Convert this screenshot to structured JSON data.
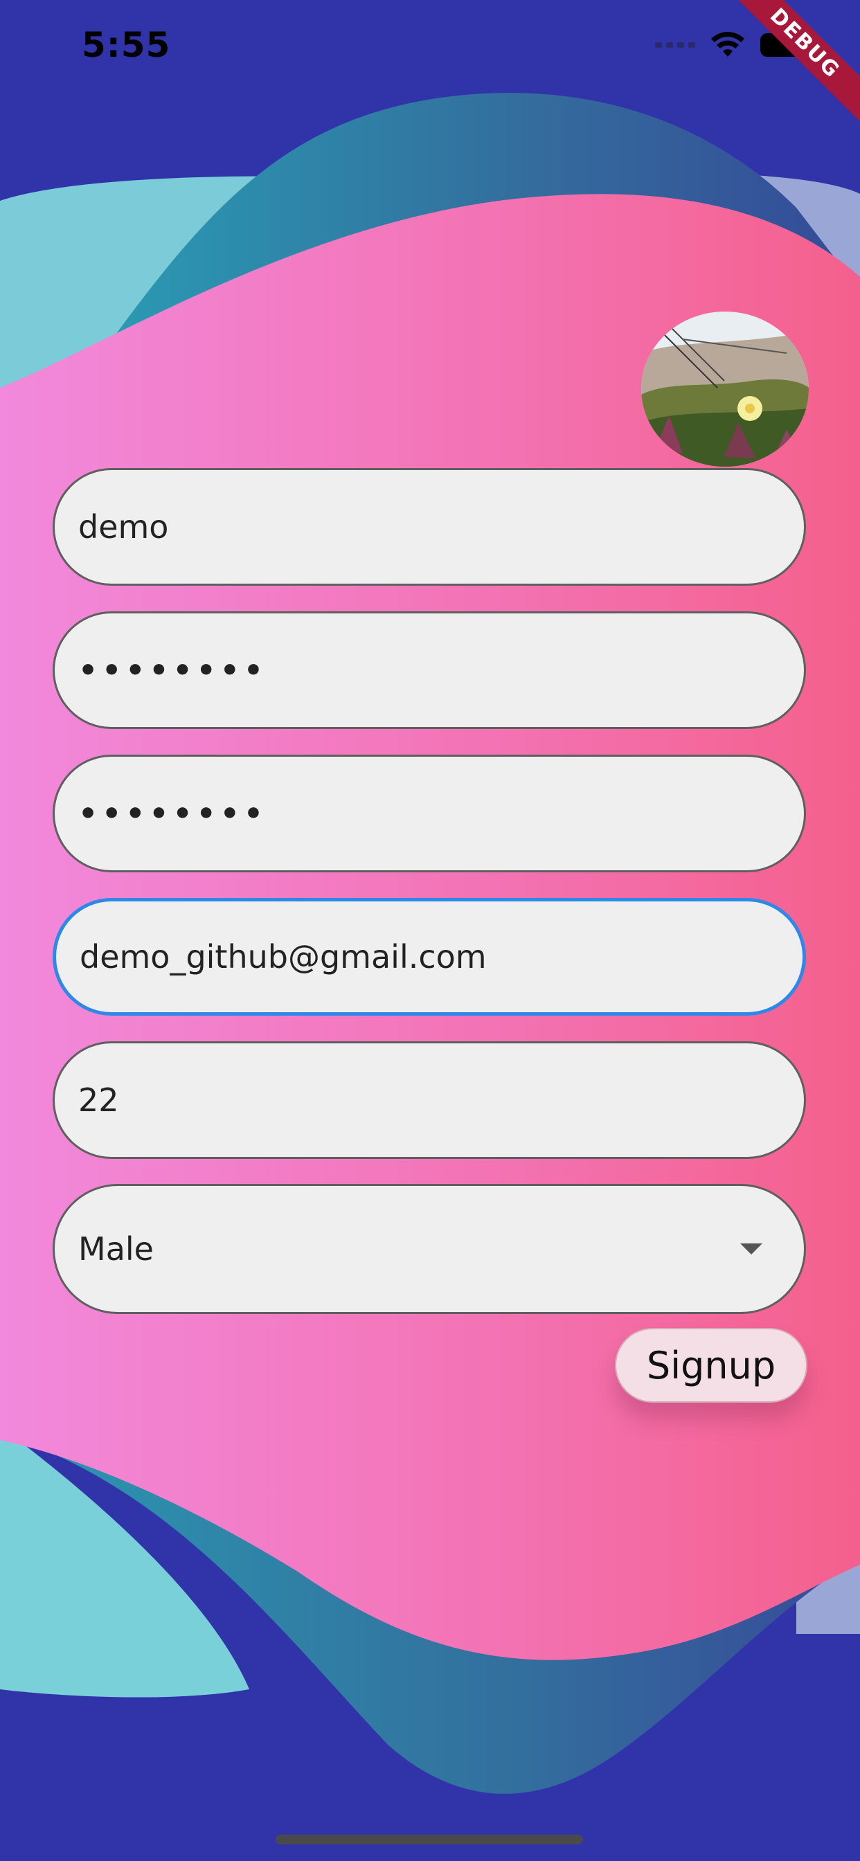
{
  "status_bar": {
    "time": "5:55",
    "debug_label": "DEBUG"
  },
  "form": {
    "username_value": "demo",
    "password_value": "••••••••",
    "confirm_password_value": "••••••••",
    "email_value": "demo_github@gmail.com",
    "age_value": "22",
    "gender_value": "Male"
  },
  "actions": {
    "signup_label": "Signup"
  },
  "colors": {
    "background": "#3133a8",
    "accent_focus": "#2e88e8",
    "field_fill": "#efefef",
    "gradient_left": "#f186db",
    "gradient_right": "#f4628e",
    "wave_teal": "#2a91b1"
  },
  "icons": {
    "wifi": "wifi-icon",
    "battery": "battery-icon",
    "dropdown": "chevron-down-icon"
  }
}
